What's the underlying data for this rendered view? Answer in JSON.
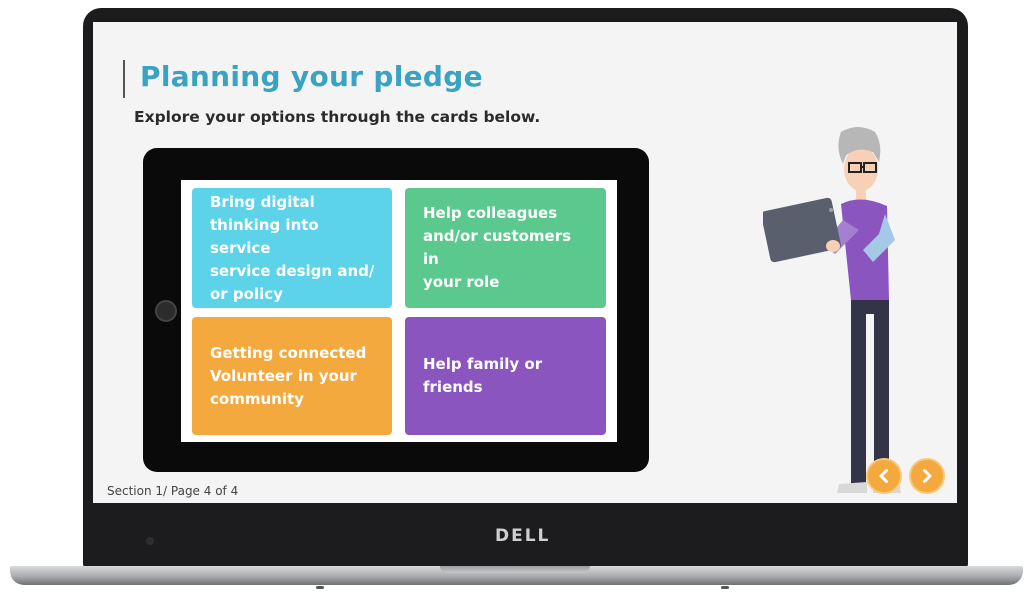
{
  "slide": {
    "title": "Planning your pledge",
    "subtitle": "Explore your options through the cards below.",
    "cards": [
      {
        "lines": [
          "Bring digital",
          "thinking into service",
          "service design and/",
          "or policy"
        ],
        "color": "#5dd3ea"
      },
      {
        "lines": [
          "Help colleagues",
          "and/or customers in",
          "your role"
        ],
        "color": "#5bc98e"
      },
      {
        "lines": [
          "Getting connected",
          "Volunteer in your",
          "community"
        ],
        "color": "#f3a93e"
      },
      {
        "lines": [
          "Help family or",
          "friends"
        ],
        "color": "#8b55bf"
      }
    ],
    "section_label": "Section 1/ Page 4 of 4",
    "nav": {
      "prev_icon": "chevron-left-icon",
      "next_icon": "chevron-right-icon",
      "accent": "#f3a93e"
    }
  },
  "laptop": {
    "brand": "DELL"
  }
}
